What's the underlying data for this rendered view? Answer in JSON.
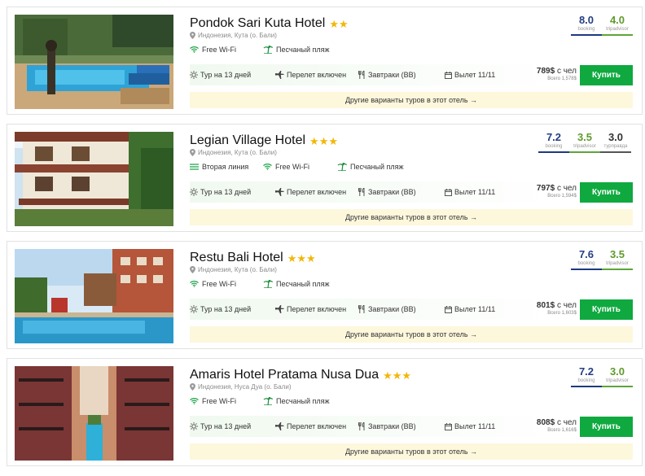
{
  "colors": {
    "buy_button": "#0fa940",
    "star": "#f2b705",
    "booking": "#1d3a80",
    "tripadvisor": "#5da53a",
    "tourprava": "#555555",
    "other_tours_bg": "#fdf7dc",
    "tour_bar_bg": "#f0f9ef"
  },
  "hotels": [
    {
      "name": "Pondok Sari Kuta Hotel",
      "stars": 2,
      "location": "Индонезия, Кута (о. Бали)",
      "amenities": [
        {
          "icon": "wifi-icon",
          "label": "Free Wi-Fi"
        },
        {
          "icon": "palm-beach-icon",
          "label": "Песчаный пляж"
        }
      ],
      "tour": {
        "duration": "Тур на 13 дней",
        "flight": "Перелет включен",
        "meals": "Завтраки (BB)",
        "departure": "Вылет 11/11",
        "price": "789$",
        "price_suffix": "с чел",
        "total": "Всего 1,578$"
      },
      "buy_label": "Купить",
      "other_tours": "Другие варианты туров в этот отель →",
      "ratings": [
        {
          "score": "8.0",
          "source": "booking"
        },
        {
          "score": "4.0",
          "source": "tripadvisor"
        }
      ]
    },
    {
      "name": "Legian Village Hotel",
      "stars": 3,
      "location": "Индонезия, Кута (о. Бали)",
      "amenities": [
        {
          "icon": "second-line-icon",
          "label": "Вторая линия"
        },
        {
          "icon": "wifi-icon",
          "label": "Free Wi-Fi"
        },
        {
          "icon": "palm-beach-icon",
          "label": "Песчаный пляж"
        }
      ],
      "tour": {
        "duration": "Тур на 13 дней",
        "flight": "Перелет включен",
        "meals": "Завтраки (BB)",
        "departure": "Вылет 11/11",
        "price": "797$",
        "price_suffix": "с чел",
        "total": "Всего 1,594$"
      },
      "buy_label": "Купить",
      "other_tours": "Другие варианты туров в этот отель →",
      "ratings": [
        {
          "score": "7.2",
          "source": "booking"
        },
        {
          "score": "3.5",
          "source": "tripadvisor"
        },
        {
          "score": "3.0",
          "source": "турправда"
        }
      ]
    },
    {
      "name": "Restu Bali Hotel",
      "stars": 3,
      "location": "Индонезия, Кута (о. Бали)",
      "amenities": [
        {
          "icon": "wifi-icon",
          "label": "Free Wi-Fi"
        },
        {
          "icon": "palm-beach-icon",
          "label": "Песчаный пляж"
        }
      ],
      "tour": {
        "duration": "Тур на 13 дней",
        "flight": "Перелет включен",
        "meals": "Завтраки (BB)",
        "departure": "Вылет 11/11",
        "price": "801$",
        "price_suffix": "с чел",
        "total": "Всего 1,603$"
      },
      "buy_label": "Купить",
      "other_tours": "Другие варианты туров в этот отель →",
      "ratings": [
        {
          "score": "7.6",
          "source": "booking"
        },
        {
          "score": "3.5",
          "source": "tripadvisor"
        }
      ]
    },
    {
      "name": "Amaris Hotel Pratama Nusa Dua",
      "stars": 3,
      "location": "Индонезия, Нуса Дуа (о. Бали)",
      "amenities": [
        {
          "icon": "wifi-icon",
          "label": "Free Wi-Fi"
        },
        {
          "icon": "palm-beach-icon",
          "label": "Песчаный пляж"
        }
      ],
      "tour": {
        "duration": "Тур на 13 дней",
        "flight": "Перелет включен",
        "meals": "Завтраки (BB)",
        "departure": "Вылет 11/11",
        "price": "808$",
        "price_suffix": "с чел",
        "total": "Всего 1,616$"
      },
      "buy_label": "Купить",
      "other_tours": "Другие варианты туров в этот отель →",
      "ratings": [
        {
          "score": "7.2",
          "source": "booking"
        },
        {
          "score": "3.0",
          "source": "tripadvisor"
        }
      ]
    }
  ]
}
